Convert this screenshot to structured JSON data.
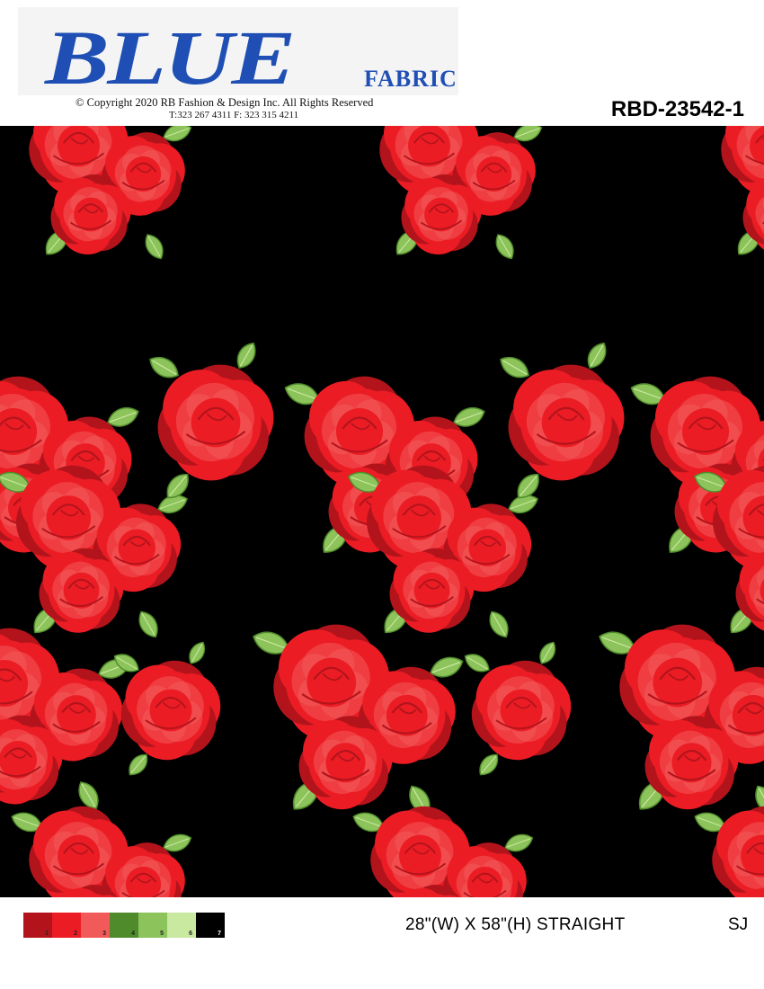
{
  "header": {
    "logo_main": "BLUE",
    "logo_sub": "FABRIC",
    "copyright": "© Copyright  2020 RB Fashion & Design Inc. All Rights Reserved",
    "phone": "T:323 267 4311   F: 323 315 4211",
    "design_code": "RBD-23542-1"
  },
  "footer": {
    "dimensions": "28\"(W) X 58\"(H) STRAIGHT",
    "tag": "SJ",
    "swatches": [
      {
        "num": "1",
        "color": "#b3141c"
      },
      {
        "num": "2",
        "color": "#ec1c24"
      },
      {
        "num": "3",
        "color": "#f25a5a"
      },
      {
        "num": "4",
        "color": "#4f8a2b"
      },
      {
        "num": "5",
        "color": "#8cc35a"
      },
      {
        "num": "6",
        "color": "#c9e8a0"
      },
      {
        "num": "7",
        "color": "#000000"
      }
    ]
  },
  "colors": {
    "brand": "#1f4fb4",
    "background": "#000000",
    "rose_dark": "#b3141c",
    "rose_mid": "#ec1c24",
    "rose_light": "#f25a5a",
    "leaf_dark": "#4f8a2b",
    "leaf_mid": "#8cc35a",
    "leaf_light": "#c9e8a0"
  }
}
